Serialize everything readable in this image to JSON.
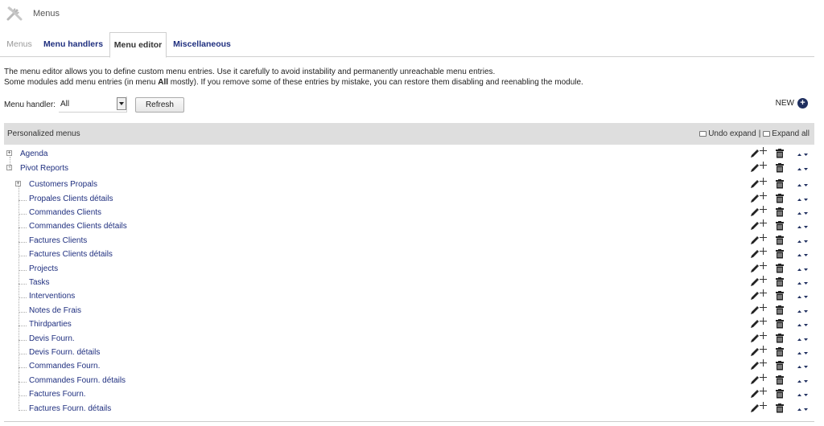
{
  "header": {
    "title": "Menus"
  },
  "tabs": [
    {
      "label": "Menus"
    },
    {
      "label": "Menu handlers"
    },
    {
      "label": "Menu editor"
    },
    {
      "label": "Miscellaneous"
    }
  ],
  "description": {
    "line1": "The menu editor allows you to define custom menu entries. Use it carefully to avoid instability and permanently unreachable menu entries.",
    "line2_pre": "Some modules add menu entries (in menu ",
    "line2_bold": "All",
    "line2_post": " mostly). If you remove some of these entries by mistake, you can restore them disabling and reenabling the module."
  },
  "filter": {
    "label": "Menu handler:",
    "value": "All",
    "refresh_label": "Refresh"
  },
  "new_label": "NEW",
  "table": {
    "title": "Personalized menus",
    "undo_label": "Undo expand",
    "separator": "|",
    "expand_label": "Expand all"
  },
  "tree": [
    {
      "label": "Agenda",
      "level": 0,
      "toggle": "+"
    },
    {
      "label": "Pivot Reports",
      "level": 0,
      "toggle": "-"
    },
    {
      "label": "Customers Propals",
      "level": 1,
      "toggle": "+"
    },
    {
      "label": "Propales Clients détails",
      "level": 1
    },
    {
      "label": "Commandes Clients",
      "level": 1
    },
    {
      "label": "Commandes Clients détails",
      "level": 1
    },
    {
      "label": "Factures Clients",
      "level": 1
    },
    {
      "label": "Factures Clients détails",
      "level": 1
    },
    {
      "label": "Projects",
      "level": 1
    },
    {
      "label": "Tasks",
      "level": 1
    },
    {
      "label": "Interventions",
      "level": 1
    },
    {
      "label": "Notes de Frais",
      "level": 1
    },
    {
      "label": "Thirdparties",
      "level": 1
    },
    {
      "label": "Devis Fourn.",
      "level": 1
    },
    {
      "label": "Devis Fourn. détails",
      "level": 1
    },
    {
      "label": "Commandes Fourn.",
      "level": 1
    },
    {
      "label": "Commandes Fourn. détails",
      "level": 1
    },
    {
      "label": "Factures Fourn.",
      "level": 1
    },
    {
      "label": "Factures Fourn. détails",
      "level": 1
    }
  ],
  "icons": {
    "edit": "pencil-icon",
    "add": "plus-icon",
    "delete": "trash-icon",
    "move": "up-down-arrows-icon"
  },
  "colors": {
    "link": "#1f2f7f",
    "header_bg": "#dedede",
    "accent": "#1f2f5f"
  }
}
